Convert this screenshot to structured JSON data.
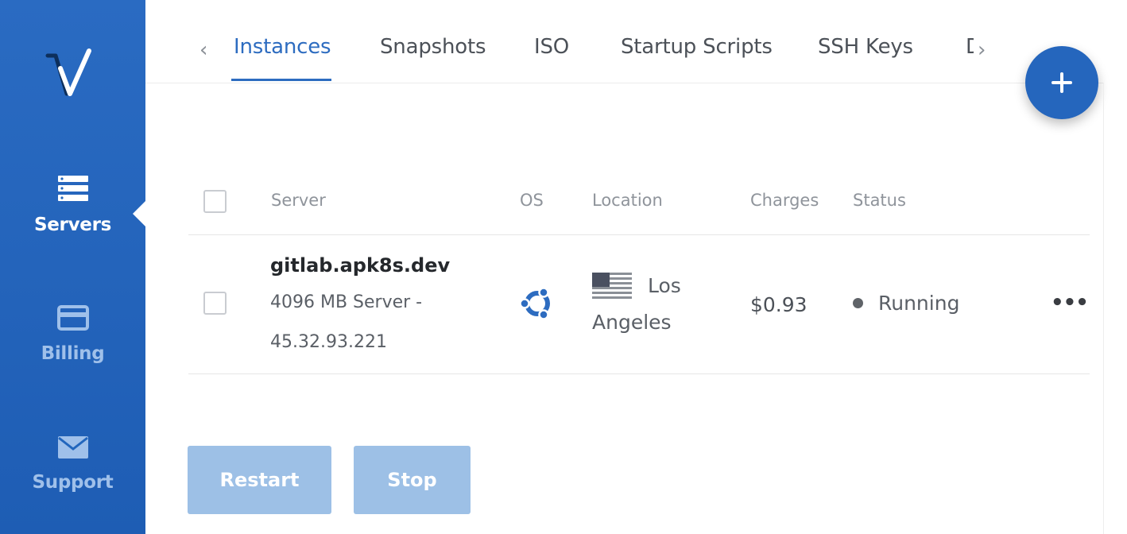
{
  "sidebar": {
    "logo_icon": "vultr-logo",
    "items": [
      {
        "label": "Servers",
        "icon": "server-stack-icon",
        "active": true
      },
      {
        "label": "Billing",
        "icon": "credit-card-icon",
        "active": false
      },
      {
        "label": "Support",
        "icon": "envelope-icon",
        "active": false
      }
    ]
  },
  "tabs": {
    "prev_arrow": "‹",
    "next_arrow": "›",
    "items": [
      {
        "label": "Instances",
        "active": true
      },
      {
        "label": "Snapshots"
      },
      {
        "label": "ISO"
      },
      {
        "label": "Startup Scripts"
      },
      {
        "label": "SSH Keys"
      },
      {
        "label": "D"
      }
    ]
  },
  "fab": {
    "icon": "plus-icon"
  },
  "table": {
    "headers": {
      "server": "Server",
      "os": "OS",
      "location": "Location",
      "charges": "Charges",
      "status": "Status"
    },
    "rows": [
      {
        "name": "gitlab.apk8s.dev",
        "detail_line1": "4096 MB Server -",
        "detail_line2": "45.32.93.221",
        "os_icon": "ubuntu-icon",
        "flag_icon": "us-flag-icon",
        "location_line1": "Los",
        "location_line2": "Angeles",
        "charges": "$0.93",
        "status": "Running",
        "more": "•••"
      }
    ]
  },
  "actions": {
    "restart_label": "Restart",
    "stop_label": "Stop"
  },
  "colors": {
    "sidebar": "#2266bd",
    "accent": "#2d6cc0",
    "button_disabled": "#9dc0e6"
  }
}
